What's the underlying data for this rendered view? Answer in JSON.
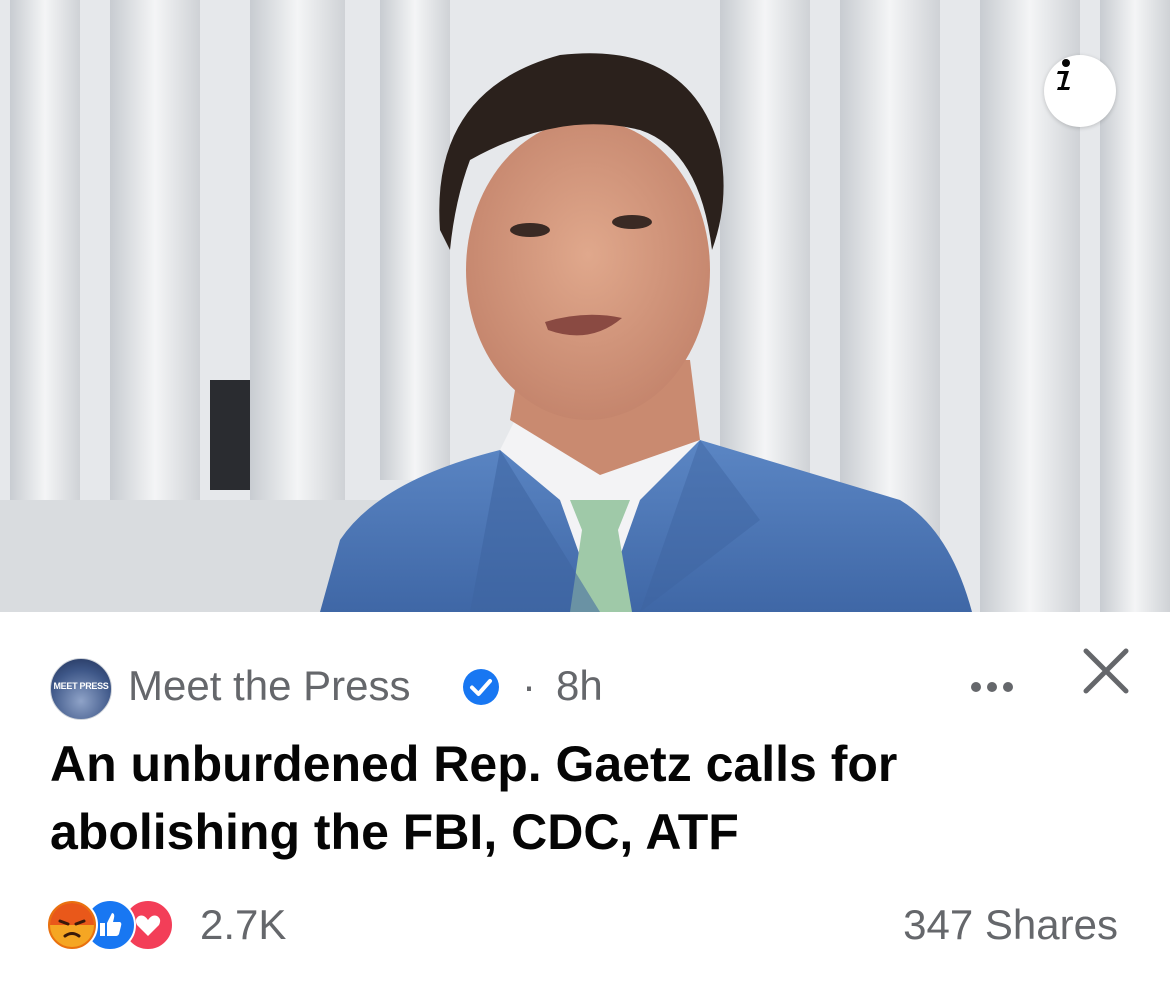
{
  "post": {
    "source_name": "Meet the Press",
    "avatar_text": "MEET PRESS",
    "separator": "·",
    "time": "8h",
    "headline": "An unburdened Rep. Gaetz calls for abolishing the FBI, CDC, ATF",
    "reaction_count": "2.7K",
    "shares": "347 Shares"
  },
  "icons": {
    "info": "info-icon",
    "verified": "verified-badge-icon",
    "more": "more-options-icon",
    "close": "close-icon",
    "reactions": [
      "angry-reaction-icon",
      "like-reaction-icon",
      "love-reaction-icon"
    ]
  },
  "colors": {
    "verified_blue": "#1877f2",
    "text_secondary": "#65676b",
    "text_primary": "#050505",
    "like_blue": "#1877f2",
    "love_red": "#f33e58",
    "angry_orange": "#e9710f",
    "suit_blue": "#4a74b4"
  }
}
